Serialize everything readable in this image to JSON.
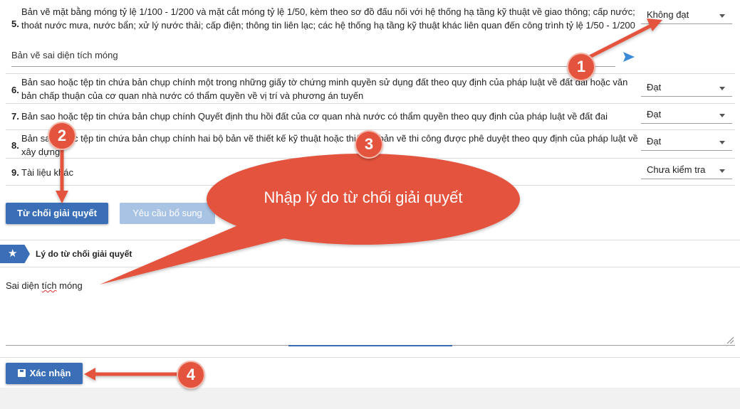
{
  "documents": [
    {
      "num": "5.",
      "text": "Bản vẽ mặt bằng móng tỷ lệ 1/100 - 1/200 và mặt cắt móng tỷ lệ 1/50, kèm theo sơ đồ đấu nối với hệ thống hạ tầng kỹ thuật về giao thông; cấp nước; thoát nước mưa, nước bẩn; xử lý nước thải; cấp điện; thông tin liên lạc; các hệ thống hạ tầng kỹ thuật khác liên quan đến công trình tỷ lệ 1/50 - 1/200",
      "status": "Không đạt",
      "note": "Bản vẽ sai diện tích móng"
    },
    {
      "num": "6.",
      "text": "Bản sao hoặc tệp tin chứa bản chụp chính một trong những giấy tờ chứng minh quyền sử dụng đất theo quy định của pháp luật về đất đai hoặc văn bản chấp thuận của cơ quan nhà nước có thẩm quyền về vị trí và phương án tuyến",
      "status": "Đạt"
    },
    {
      "num": "7.",
      "text": "Bản sao hoặc tệp tin chứa bản chụp chính Quyết định thu hồi đất của cơ quan nhà nước có thẩm quyền theo quy định của pháp luật về đất đai",
      "status": "Đạt"
    },
    {
      "num": "8.",
      "text": "Bản sao hoặc tệp tin chứa bản chụp chính hai bộ bản vẽ thiết kế kỹ thuật hoặc thiết kế bản vẽ thi công được phê duyệt theo quy định của pháp luật về xây dựng",
      "status": "Đạt"
    },
    {
      "num": "9.",
      "text": "Tài liệu khác",
      "status": "Chưa kiểm tra"
    }
  ],
  "actions": {
    "reject_label": "Từ chối giải quyết",
    "supplement_label": "Yêu cầu bổ sung",
    "confirm_label": "Xác nhận"
  },
  "reason": {
    "title": "Lý do từ chối giải quyết",
    "value_prefix": "Sai diện ",
    "value_misspelled": "tích",
    "value_suffix": " móng"
  },
  "annotations": {
    "badges": [
      "1",
      "2",
      "3",
      "4"
    ],
    "bubble_text": "Nhập lý do từ chối giải quyết"
  },
  "colors": {
    "primary": "#3a6fb8",
    "primary_disabled": "#a8c3e4",
    "callout": "#e4533d"
  }
}
